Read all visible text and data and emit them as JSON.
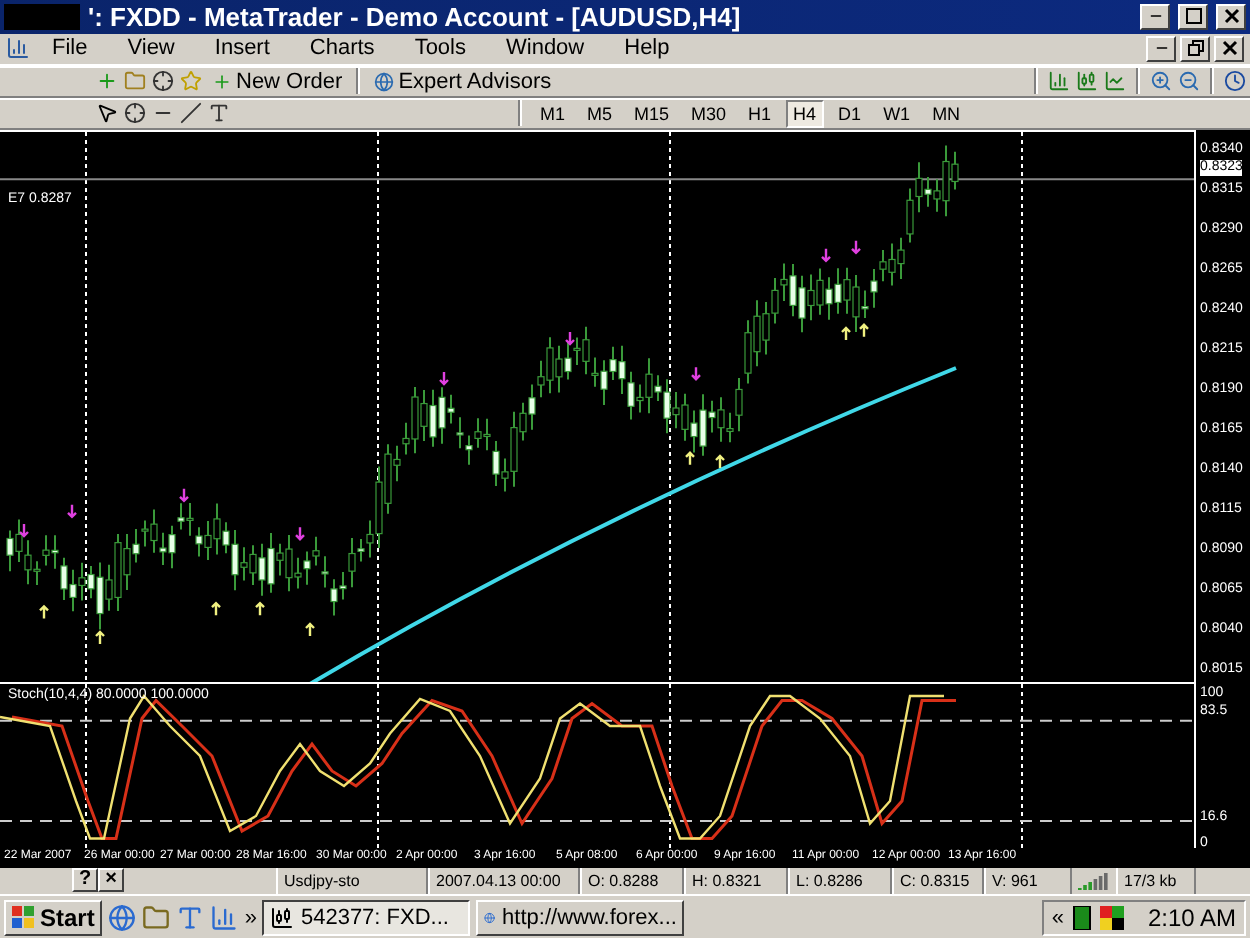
{
  "window": {
    "title": "': FXDD - MetaTrader - Demo Account - [AUDUSD,H4]"
  },
  "menu": [
    "File",
    "View",
    "Insert",
    "Charts",
    "Tools",
    "Window",
    "Help"
  ],
  "toolbar": {
    "new_order": "New Order",
    "expert_advisors": "Expert Advisors"
  },
  "timeframes": [
    {
      "label": "M1",
      "selected": false
    },
    {
      "label": "M5",
      "selected": false
    },
    {
      "label": "M15",
      "selected": false
    },
    {
      "label": "M30",
      "selected": false
    },
    {
      "label": "H1",
      "selected": false
    },
    {
      "label": "H4",
      "selected": true
    },
    {
      "label": "D1",
      "selected": false
    },
    {
      "label": "W1",
      "selected": false
    },
    {
      "label": "MN",
      "selected": false
    }
  ],
  "chart": {
    "level_label": "E7 0.8287",
    "price_ticks": [
      "0.8340",
      "0.8315",
      "0.8290",
      "0.8265",
      "0.8240",
      "0.8215",
      "0.8190",
      "0.8165",
      "0.8140",
      "0.8115",
      "0.8090",
      "0.8065",
      "0.8040",
      "0.8015"
    ],
    "current_price": "0.8323"
  },
  "indicator": {
    "label": "Stoch(10,4,4) 80.0000 100.0000",
    "ticks": [
      "100",
      "83.5",
      "16.6",
      "0"
    ]
  },
  "time_axis": [
    "22 Mar 2007",
    "26 Mar 00:00",
    "27 Mar 00:00",
    "28 Mar 16:00",
    "30 Mar 00:00",
    "2 Apr 00:00",
    "3 Apr 16:00",
    "5 Apr 08:00",
    "6 Apr 00:00",
    "9 Apr 16:00",
    "11 Apr 00:00",
    "12 Apr 00:00",
    "13 Apr 16:00"
  ],
  "status_bar": {
    "help": "?",
    "close": "×",
    "profile": "Usdjpy-sto",
    "time": "2007.04.13 00:00",
    "open": "O: 0.8288",
    "high": "H: 0.8321",
    "low": "L: 0.8286",
    "close_price": "C: 0.8315",
    "volume": "V: 961",
    "traffic": "17/3 kb"
  },
  "taskbar": {
    "start": "Start",
    "more": "»",
    "tasks": [
      {
        "label": "542377: FXD...",
        "selected": true
      },
      {
        "label": "http://www.forex...",
        "selected": false
      }
    ],
    "tray_more": "«",
    "clock": "2:10 AM"
  }
}
